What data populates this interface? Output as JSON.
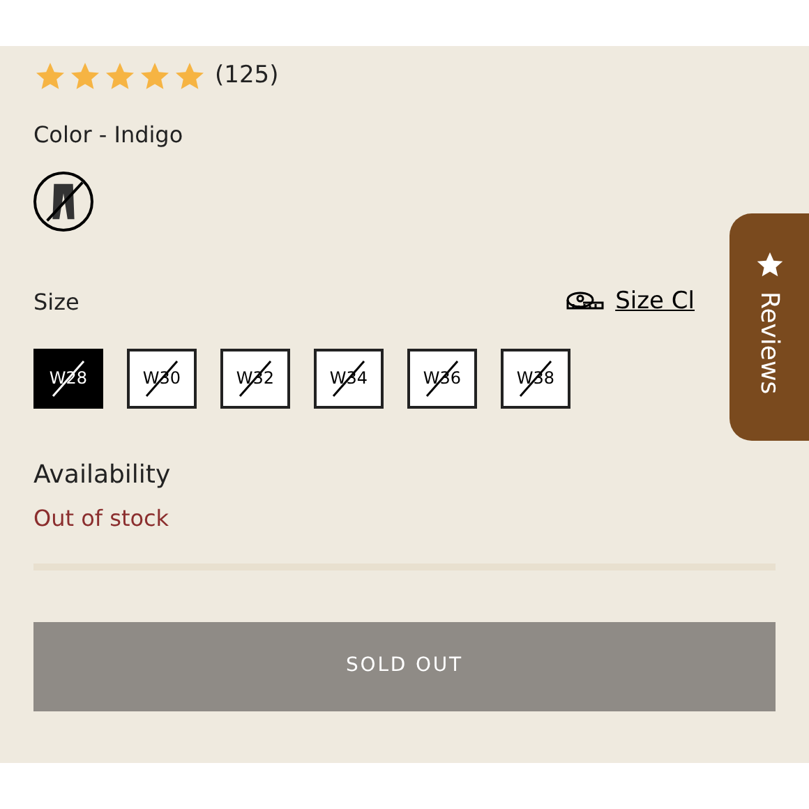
{
  "rating": {
    "stars": 5,
    "count": "(125)"
  },
  "color": {
    "label": "Color - Indigo",
    "swatches": [
      {
        "selected": true,
        "available": false
      }
    ]
  },
  "size": {
    "label": "Size",
    "chart_link": "Size Cl",
    "options": [
      {
        "label": "W28",
        "selected": true,
        "available": false
      },
      {
        "label": "W30",
        "selected": false,
        "available": false
      },
      {
        "label": "W32",
        "selected": false,
        "available": false
      },
      {
        "label": "W34",
        "selected": false,
        "available": false
      },
      {
        "label": "W36",
        "selected": false,
        "available": false
      },
      {
        "label": "W38",
        "selected": false,
        "available": false
      }
    ]
  },
  "availability": {
    "label": "Availability",
    "status": "Out of stock"
  },
  "button": {
    "label": "SOLD OUT",
    "disabled": true
  },
  "reviews_tab": {
    "label": "Reviews"
  }
}
